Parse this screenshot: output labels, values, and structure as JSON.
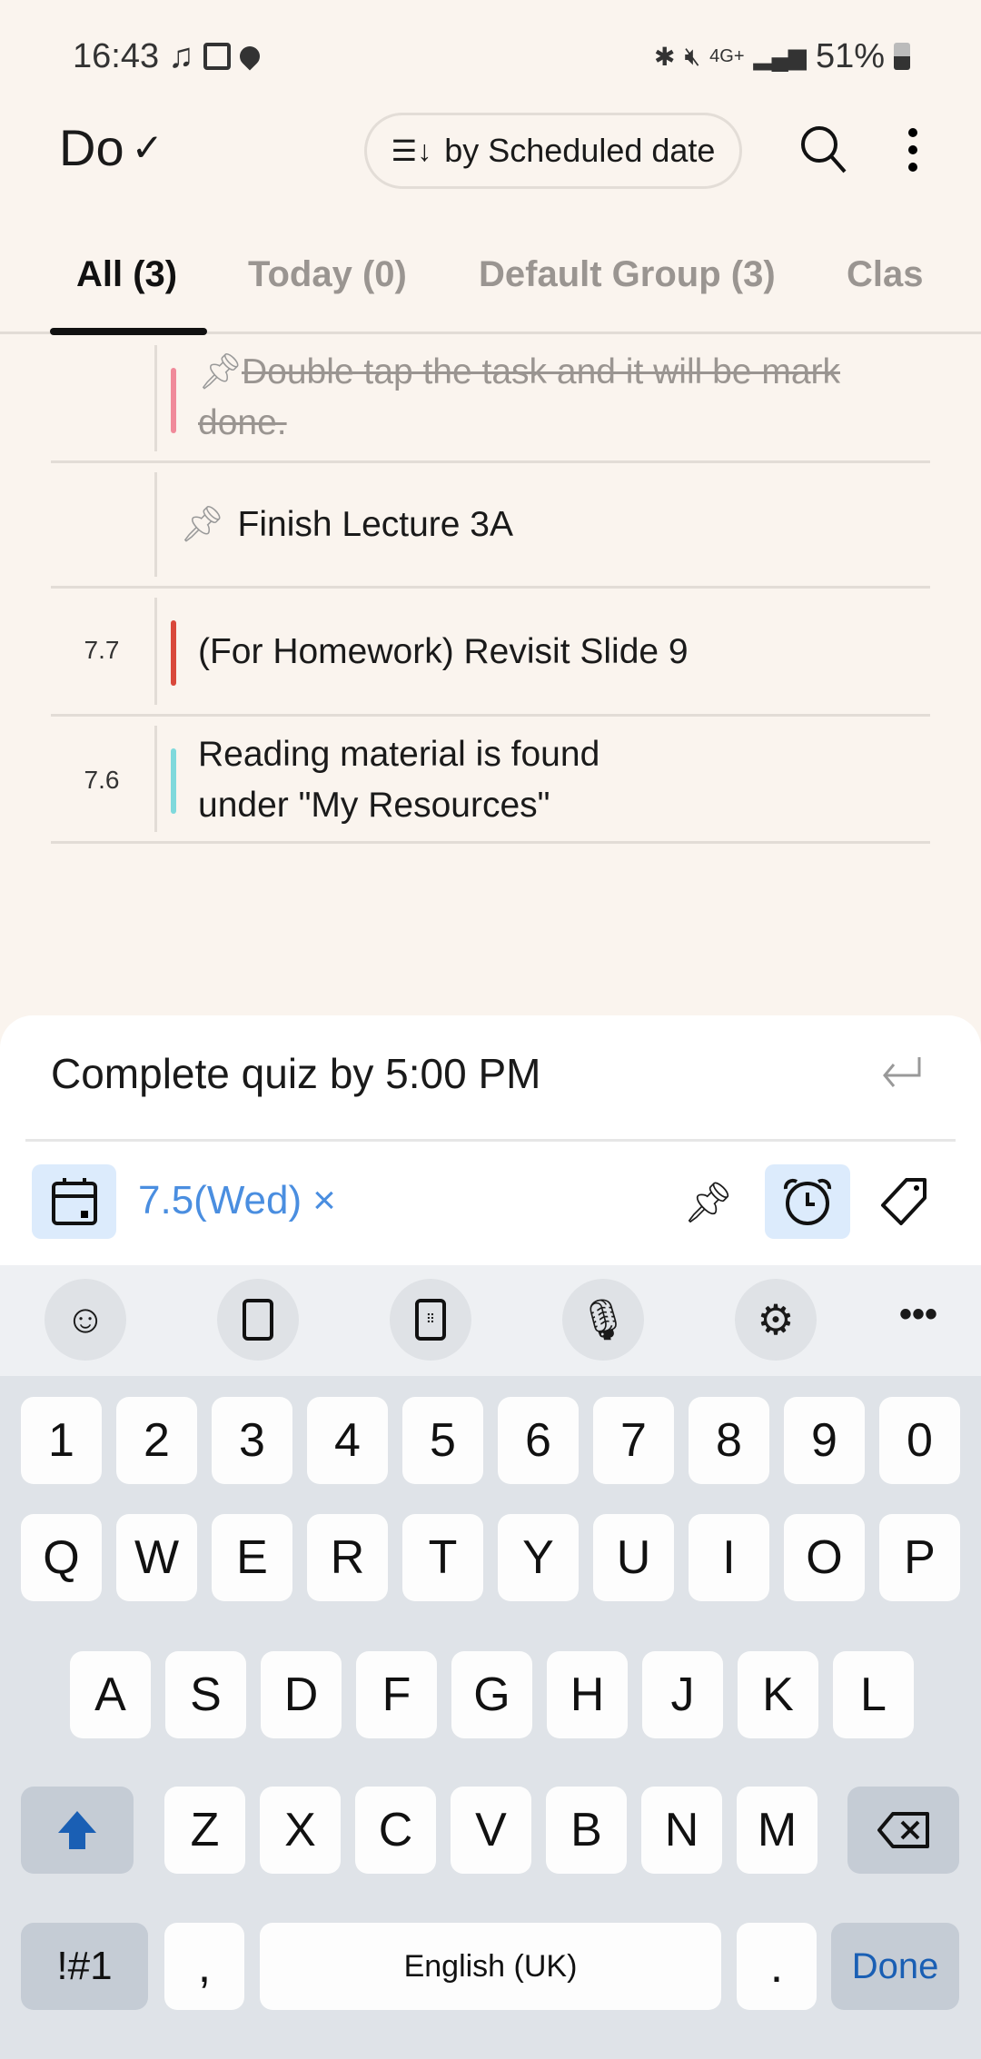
{
  "status_bar": {
    "time": "16:43",
    "battery": "51%",
    "network": "4G+"
  },
  "header": {
    "logo": "Do",
    "sort_label": "by Scheduled date"
  },
  "tabs": [
    {
      "label": "All (3)"
    },
    {
      "label": "Today (0)"
    },
    {
      "label": "Default Group (3)"
    },
    {
      "label": "Clas"
    }
  ],
  "tasks": [
    {
      "date": "",
      "text": "Double tap the task and it will be mark done.",
      "done": true,
      "pinned": true,
      "color": "#f08a9a"
    },
    {
      "date": "",
      "text": "Finish Lecture 3A",
      "done": false,
      "pinned": true,
      "color": ""
    },
    {
      "date": "7.7",
      "text": "(For Homework) Revisit Slide 9",
      "done": false,
      "pinned": false,
      "color": "#d9483b"
    },
    {
      "date": "7.6",
      "text": "Reading material is found under \"My Resources\"",
      "done": false,
      "pinned": false,
      "color": "#7fd9dc"
    }
  ],
  "composer": {
    "input_value": "Complete quiz by 5:00 PM",
    "date_chip": "7.5(Wed)",
    "remove_symbol": "×",
    "accent": "#4a8ee0"
  },
  "keyboard": {
    "row1": [
      "1",
      "2",
      "3",
      "4",
      "5",
      "6",
      "7",
      "8",
      "9",
      "0"
    ],
    "row2": [
      "Q",
      "W",
      "E",
      "R",
      "T",
      "Y",
      "U",
      "I",
      "O",
      "P"
    ],
    "row3": [
      "A",
      "S",
      "D",
      "F",
      "G",
      "H",
      "J",
      "K",
      "L"
    ],
    "row4": [
      "Z",
      "X",
      "C",
      "V",
      "B",
      "N",
      "M"
    ],
    "symbols": "!#1",
    "comma": ",",
    "space": "English (UK)",
    "period": ".",
    "done": "Done"
  }
}
